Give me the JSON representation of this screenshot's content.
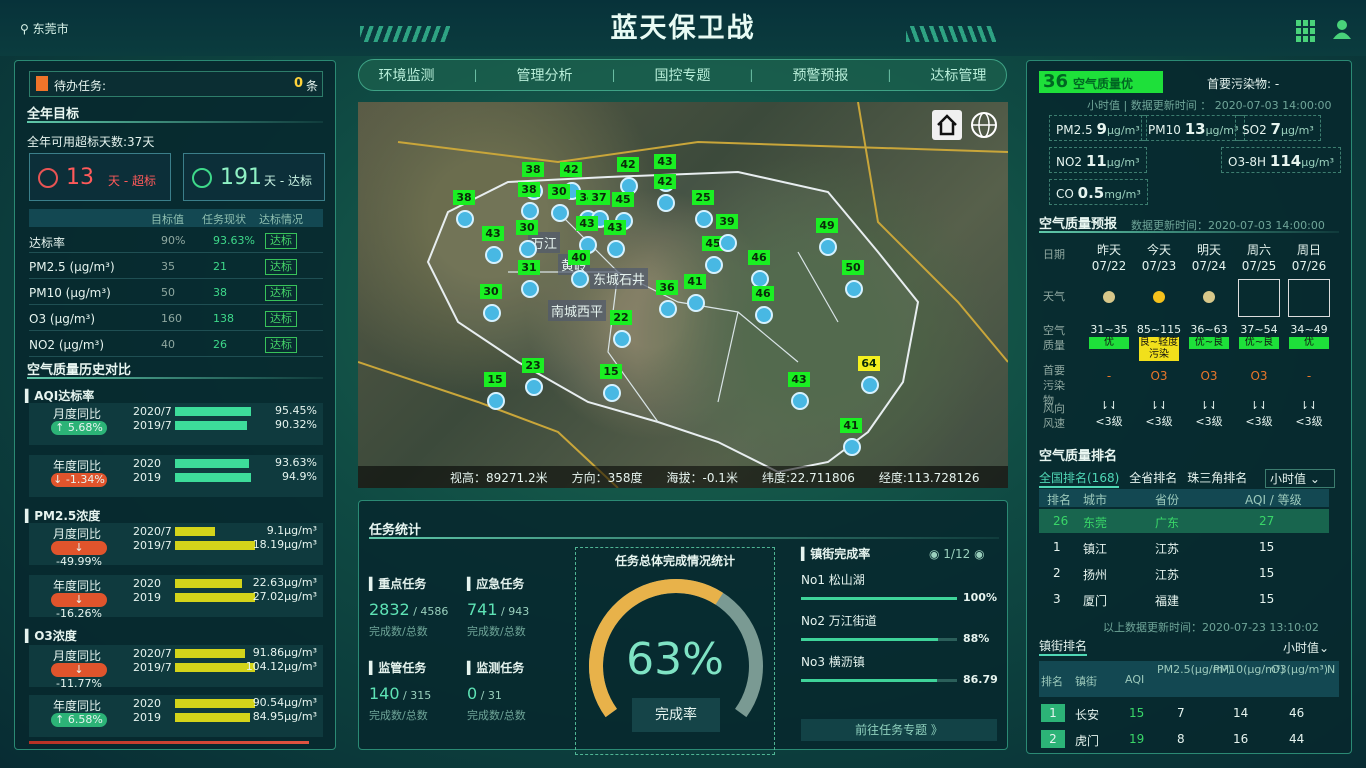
{
  "header": {
    "title": "蓝天保卫战",
    "city": "东莞市"
  },
  "nav": [
    "环境监测",
    "管理分析",
    "国控专题",
    "预警预报",
    "达标管理"
  ],
  "left": {
    "todo_label": "待办任务:",
    "todo_count": "0",
    "todo_unit": "条",
    "year_goal_title": "全年目标",
    "year_goal_days": "全年可用超标天数:37天",
    "over_days": "13",
    "over_label": "天 - 超标",
    "ok_days": "191",
    "ok_label": "天 - 达标",
    "table_headers": [
      "目标值",
      "任务现状",
      "达标情况"
    ],
    "rows": [
      {
        "name": "达标率",
        "target": "90%",
        "current": "93.63%",
        "status": "达标"
      },
      {
        "name": "PM2.5 (μg/m³)",
        "target": "35",
        "current": "21",
        "status": "达标"
      },
      {
        "name": "PM10 (μg/m³)",
        "target": "50",
        "current": "38",
        "status": "达标"
      },
      {
        "name": "O3 (μg/m³)",
        "target": "160",
        "current": "138",
        "status": "达标"
      },
      {
        "name": "NO2 (μg/m³)",
        "target": "40",
        "current": "26",
        "status": "达标"
      }
    ],
    "history_title": "空气质量历史对比",
    "aqi_title": "AQI达标率",
    "pm25_title": "PM2.5浓度",
    "o3_title": "O3浓度",
    "comparisons": [
      {
        "label": "月度同比",
        "change": "5.68%",
        "up": true,
        "y1": "2020/7",
        "v1": "95.45%",
        "f1": 0.95,
        "y2": "2019/7",
        "v2": "90.32%",
        "f2": 0.9,
        "color": "#3ddc9a"
      },
      {
        "label": "年度同比",
        "change": "-1.34%",
        "up": false,
        "y1": "2020",
        "v1": "93.63%",
        "f1": 0.93,
        "y2": "2019",
        "v2": "94.9%",
        "f2": 0.95,
        "color": "#3ddc9a"
      },
      {
        "label": "月度同比",
        "change": "-49.99%",
        "up": false,
        "y1": "2020/7",
        "v1": "9.1μg/m³",
        "f1": 0.5,
        "y2": "2019/7",
        "v2": "18.19μg/m³",
        "f2": 1.0,
        "color": "#d4d41a"
      },
      {
        "label": "年度同比",
        "change": "-16.26%",
        "up": false,
        "y1": "2020",
        "v1": "22.63μg/m³",
        "f1": 0.84,
        "y2": "2019",
        "v2": "27.02μg/m³",
        "f2": 1.0,
        "color": "#d4d41a"
      },
      {
        "label": "月度同比",
        "change": "-11.77%",
        "up": false,
        "y1": "2020/7",
        "v1": "91.86μg/m³",
        "f1": 0.88,
        "y2": "2019/7",
        "v2": "104.12μg/m³",
        "f2": 1.0,
        "color": "#d4d41a"
      },
      {
        "label": "年度同比",
        "change": "6.58%",
        "up": true,
        "y1": "2020",
        "v1": "90.54μg/m³",
        "f1": 1.0,
        "y2": "2019",
        "v2": "84.95μg/m³",
        "f2": 0.94,
        "color": "#d4d41a"
      }
    ]
  },
  "map": {
    "status": {
      "height": "视高：89271.2米",
      "dir": "方向：358度",
      "alt": "海拔：-0.1米",
      "lat": "纬度:22.711806",
      "lng": "经度:113.728126"
    },
    "labels": [
      "万江",
      "南城西平",
      "东城石井",
      "黄岭"
    ],
    "markers": [
      "38",
      "42",
      "42",
      "43",
      "42",
      "38",
      "30",
      "34",
      "37",
      "45",
      "25",
      "38",
      "30",
      "43",
      "43",
      "45",
      "39",
      "49",
      "43",
      "31",
      "40",
      "41",
      "36",
      "46",
      "50",
      "46",
      "30",
      "22",
      "23",
      "15",
      "15",
      "43",
      "64",
      "41"
    ]
  },
  "task": {
    "title": "任务统计",
    "items": [
      {
        "name": "重点任务",
        "done": "2832",
        "total": "/ 4586",
        "sub": "完成数/总数"
      },
      {
        "name": "应急任务",
        "done": "741",
        "total": "/ 943",
        "sub": "完成数/总数"
      },
      {
        "name": "监管任务",
        "done": "140",
        "total": "/ 315",
        "sub": "完成数/总数"
      },
      {
        "name": "监测任务",
        "done": "0",
        "total": "/ 31",
        "sub": "完成数/总数"
      }
    ],
    "gauge_title": "任务总体完成情况统计",
    "gauge_value": "63%",
    "gauge_fraction": 0.63,
    "gauge_label": "完成率",
    "town_title": "镇街完成率",
    "page": "1/12",
    "towns": [
      {
        "name": "No1 松山湖",
        "pct": "100%",
        "f": 1.0
      },
      {
        "name": "No2 万江街道",
        "pct": "88%",
        "f": 0.88
      },
      {
        "name": "No3 横沥镇",
        "pct": "86.79",
        "f": 0.87
      }
    ],
    "goto": "前往任务专题 》"
  },
  "right": {
    "aqi": "36",
    "aqi_label": "空气质量优",
    "primary": "首要污染物: -",
    "update": "小时值 | 数据更新时间 ： 2020-07-03 14:00:00",
    "pollutants": [
      {
        "n": "PM2.5",
        "v": "9",
        "u": "μg/m³"
      },
      {
        "n": "PM10",
        "v": "13",
        "u": "μg/m³"
      },
      {
        "n": "SO2",
        "v": "7",
        "u": "μg/m³"
      },
      {
        "n": "NO2",
        "v": "11",
        "u": "μg/m³"
      },
      {
        "n": "O3-8H",
        "v": "114",
        "u": "μg/m³"
      },
      {
        "n": "CO",
        "v": "0.5",
        "u": "mg/m³"
      }
    ],
    "forecast_title": "空气质量预报",
    "forecast_update": "数据更新时间：2020-07-03 14:00:00",
    "row_labels": [
      "日期",
      "天气",
      "空气质量",
      "首要污染物",
      "风向风速"
    ],
    "days": [
      {
        "d": "昨天",
        "date": "07/22",
        "range": "31~35",
        "q": "优",
        "qc": "#1ee03a",
        "p": "-",
        "wind": "<3级",
        "icon": "cloud"
      },
      {
        "d": "今天",
        "date": "07/23",
        "range": "85~115",
        "q": "良~轻度污染",
        "qc": "#f1e01b",
        "p": "O3",
        "wind": "<3级",
        "icon": "sun"
      },
      {
        "d": "明天",
        "date": "07/24",
        "range": "36~63",
        "q": "优~良",
        "qc": "#1ee03a",
        "p": "O3",
        "wind": "<3级",
        "icon": "cloud"
      },
      {
        "d": "周六",
        "date": "07/25",
        "range": "37~54",
        "q": "优~良",
        "qc": "#1ee03a",
        "p": "O3",
        "wind": "<3级",
        "icon": "box"
      },
      {
        "d": "周日",
        "date": "07/26",
        "range": "34~49",
        "q": "优",
        "qc": "#1ee03a",
        "p": "-",
        "wind": "<3级",
        "icon": "box"
      }
    ],
    "rank_title": "空气质量排名",
    "rank_tabs": [
      "全国排名(168)",
      "全省排名",
      "珠三角排名"
    ],
    "rank_select": "小时值",
    "rank_headers": [
      "排名",
      "城市",
      "省份",
      "AQI / 等级"
    ],
    "ranks": [
      {
        "r": "26",
        "c": "东莞",
        "p": "广东",
        "a": "27"
      },
      {
        "r": "1",
        "c": "镇江",
        "p": "江苏",
        "a": "15"
      },
      {
        "r": "2",
        "c": "扬州",
        "p": "江苏",
        "a": "15"
      },
      {
        "r": "3",
        "c": "厦门",
        "p": "福建",
        "a": "15"
      }
    ],
    "rank_update": "以上数据更新时间：2020-07-23 13:10:02",
    "town_rank_title": "镇街排名",
    "town_select": "小时值",
    "town_headers": [
      "排名",
      "镇街",
      "AQI",
      "PM2.5(μg/m³)",
      "PM10(μg/m³)",
      "O3(μg/m³)",
      "N"
    ],
    "town_rows": [
      {
        "r": "1",
        "n": "长安",
        "aqi": "15",
        "pm25": "7",
        "pm10": "14",
        "o3": "46"
      },
      {
        "r": "2",
        "n": "虎门",
        "aqi": "19",
        "pm25": "8",
        "pm10": "16",
        "o3": "44"
      }
    ]
  }
}
